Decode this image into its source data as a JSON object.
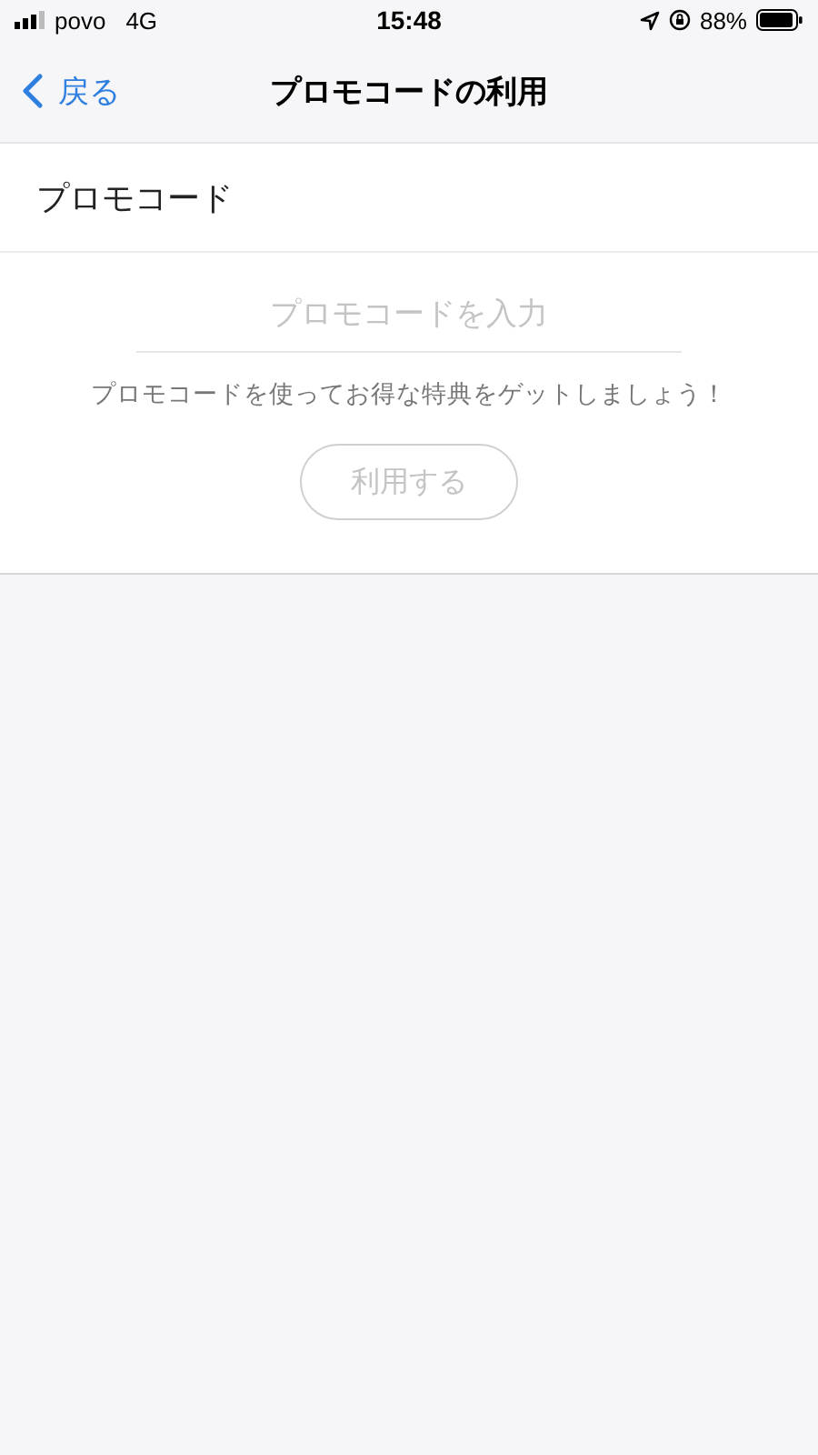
{
  "status_bar": {
    "carrier": "povo",
    "network": "4G",
    "time": "15:48",
    "battery": "88%"
  },
  "nav": {
    "back": "戻る",
    "title": "プロモコードの利用"
  },
  "section": {
    "title": "プロモコード"
  },
  "promo_field": {
    "placeholder": "プロモコードを入力"
  },
  "message": "プロモコードを使ってお得な特典をゲットしましょう！",
  "apply_button": {
    "label": "利用する",
    "disabled": true
  }
}
